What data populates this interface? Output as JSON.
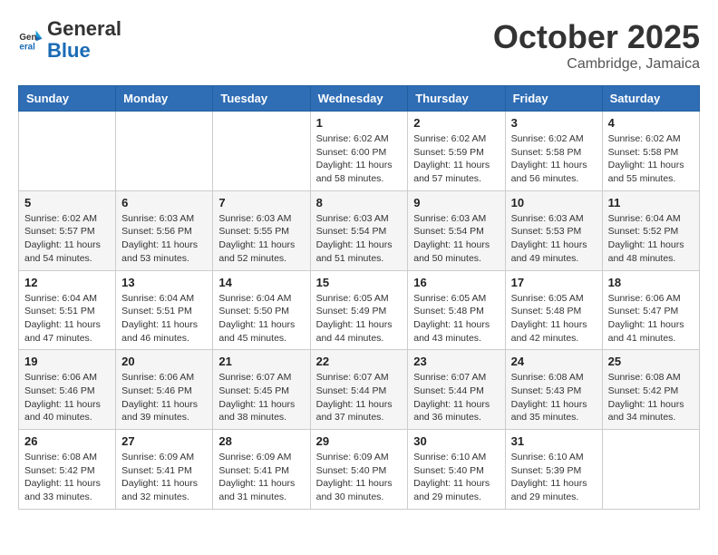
{
  "header": {
    "logo_line1": "General",
    "logo_line2": "Blue",
    "month": "October 2025",
    "location": "Cambridge, Jamaica"
  },
  "days_of_week": [
    "Sunday",
    "Monday",
    "Tuesday",
    "Wednesday",
    "Thursday",
    "Friday",
    "Saturday"
  ],
  "weeks": [
    [
      {
        "day": "",
        "info": ""
      },
      {
        "day": "",
        "info": ""
      },
      {
        "day": "",
        "info": ""
      },
      {
        "day": "1",
        "info": "Sunrise: 6:02 AM\nSunset: 6:00 PM\nDaylight: 11 hours\nand 58 minutes."
      },
      {
        "day": "2",
        "info": "Sunrise: 6:02 AM\nSunset: 5:59 PM\nDaylight: 11 hours\nand 57 minutes."
      },
      {
        "day": "3",
        "info": "Sunrise: 6:02 AM\nSunset: 5:58 PM\nDaylight: 11 hours\nand 56 minutes."
      },
      {
        "day": "4",
        "info": "Sunrise: 6:02 AM\nSunset: 5:58 PM\nDaylight: 11 hours\nand 55 minutes."
      }
    ],
    [
      {
        "day": "5",
        "info": "Sunrise: 6:02 AM\nSunset: 5:57 PM\nDaylight: 11 hours\nand 54 minutes."
      },
      {
        "day": "6",
        "info": "Sunrise: 6:03 AM\nSunset: 5:56 PM\nDaylight: 11 hours\nand 53 minutes."
      },
      {
        "day": "7",
        "info": "Sunrise: 6:03 AM\nSunset: 5:55 PM\nDaylight: 11 hours\nand 52 minutes."
      },
      {
        "day": "8",
        "info": "Sunrise: 6:03 AM\nSunset: 5:54 PM\nDaylight: 11 hours\nand 51 minutes."
      },
      {
        "day": "9",
        "info": "Sunrise: 6:03 AM\nSunset: 5:54 PM\nDaylight: 11 hours\nand 50 minutes."
      },
      {
        "day": "10",
        "info": "Sunrise: 6:03 AM\nSunset: 5:53 PM\nDaylight: 11 hours\nand 49 minutes."
      },
      {
        "day": "11",
        "info": "Sunrise: 6:04 AM\nSunset: 5:52 PM\nDaylight: 11 hours\nand 48 minutes."
      }
    ],
    [
      {
        "day": "12",
        "info": "Sunrise: 6:04 AM\nSunset: 5:51 PM\nDaylight: 11 hours\nand 47 minutes."
      },
      {
        "day": "13",
        "info": "Sunrise: 6:04 AM\nSunset: 5:51 PM\nDaylight: 11 hours\nand 46 minutes."
      },
      {
        "day": "14",
        "info": "Sunrise: 6:04 AM\nSunset: 5:50 PM\nDaylight: 11 hours\nand 45 minutes."
      },
      {
        "day": "15",
        "info": "Sunrise: 6:05 AM\nSunset: 5:49 PM\nDaylight: 11 hours\nand 44 minutes."
      },
      {
        "day": "16",
        "info": "Sunrise: 6:05 AM\nSunset: 5:48 PM\nDaylight: 11 hours\nand 43 minutes."
      },
      {
        "day": "17",
        "info": "Sunrise: 6:05 AM\nSunset: 5:48 PM\nDaylight: 11 hours\nand 42 minutes."
      },
      {
        "day": "18",
        "info": "Sunrise: 6:06 AM\nSunset: 5:47 PM\nDaylight: 11 hours\nand 41 minutes."
      }
    ],
    [
      {
        "day": "19",
        "info": "Sunrise: 6:06 AM\nSunset: 5:46 PM\nDaylight: 11 hours\nand 40 minutes."
      },
      {
        "day": "20",
        "info": "Sunrise: 6:06 AM\nSunset: 5:46 PM\nDaylight: 11 hours\nand 39 minutes."
      },
      {
        "day": "21",
        "info": "Sunrise: 6:07 AM\nSunset: 5:45 PM\nDaylight: 11 hours\nand 38 minutes."
      },
      {
        "day": "22",
        "info": "Sunrise: 6:07 AM\nSunset: 5:44 PM\nDaylight: 11 hours\nand 37 minutes."
      },
      {
        "day": "23",
        "info": "Sunrise: 6:07 AM\nSunset: 5:44 PM\nDaylight: 11 hours\nand 36 minutes."
      },
      {
        "day": "24",
        "info": "Sunrise: 6:08 AM\nSunset: 5:43 PM\nDaylight: 11 hours\nand 35 minutes."
      },
      {
        "day": "25",
        "info": "Sunrise: 6:08 AM\nSunset: 5:42 PM\nDaylight: 11 hours\nand 34 minutes."
      }
    ],
    [
      {
        "day": "26",
        "info": "Sunrise: 6:08 AM\nSunset: 5:42 PM\nDaylight: 11 hours\nand 33 minutes."
      },
      {
        "day": "27",
        "info": "Sunrise: 6:09 AM\nSunset: 5:41 PM\nDaylight: 11 hours\nand 32 minutes."
      },
      {
        "day": "28",
        "info": "Sunrise: 6:09 AM\nSunset: 5:41 PM\nDaylight: 11 hours\nand 31 minutes."
      },
      {
        "day": "29",
        "info": "Sunrise: 6:09 AM\nSunset: 5:40 PM\nDaylight: 11 hours\nand 30 minutes."
      },
      {
        "day": "30",
        "info": "Sunrise: 6:10 AM\nSunset: 5:40 PM\nDaylight: 11 hours\nand 29 minutes."
      },
      {
        "day": "31",
        "info": "Sunrise: 6:10 AM\nSunset: 5:39 PM\nDaylight: 11 hours\nand 29 minutes."
      },
      {
        "day": "",
        "info": ""
      }
    ]
  ]
}
